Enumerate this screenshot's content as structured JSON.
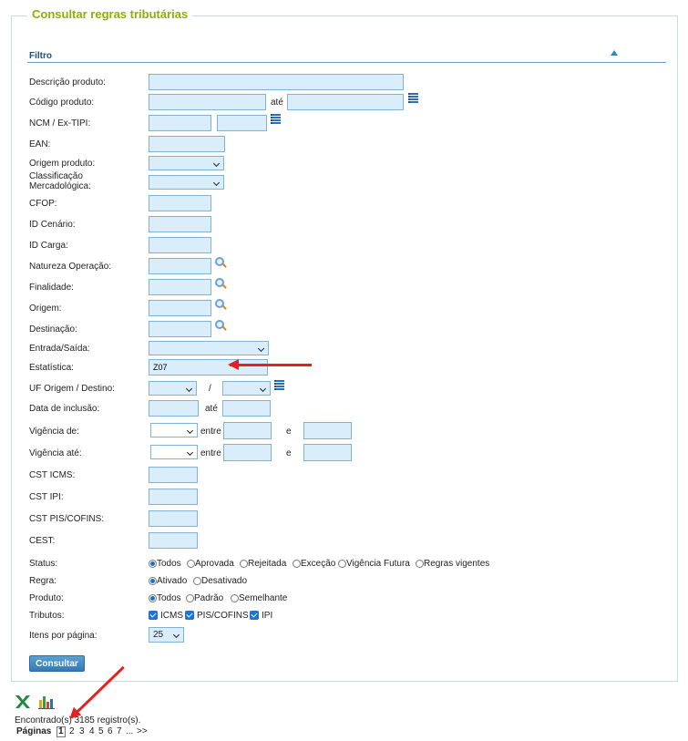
{
  "title": "Consultar regras tributárias",
  "filter": {
    "header": "Filtro"
  },
  "labels": {
    "descricao": "Descrição produto:",
    "codigo": "Código produto:",
    "ncm": "NCM / Ex-TIPI:",
    "ean": "EAN:",
    "origem_produto": "Origem produto:",
    "classificacao_1": "Classificação",
    "classificacao_2": "Mercadológica:",
    "cfop": "CFOP:",
    "id_cenario": "ID Cenário:",
    "id_carga": "ID Carga:",
    "natureza": "Natureza Operação:",
    "finalidade": "Finalidade:",
    "origem": "Origem:",
    "destinacao": "Destinação:",
    "entrada_saida": "Entrada/Saída:",
    "estatistica": "Estatística:",
    "uf": "UF Origem / Destino:",
    "data_inclusao": "Data de inclusão:",
    "vigencia_de": "Vigência de:",
    "vigencia_ate": "Vigência até:",
    "cst_icms": "CST ICMS:",
    "cst_ipi": "CST IPI:",
    "cst_pis": "CST PIS/COFINS:",
    "cest": "CEST:",
    "status": "Status:",
    "regra": "Regra:",
    "produto": "Produto:",
    "tributos": "Tributos:",
    "itens": "Itens por página:"
  },
  "words": {
    "ate": "até",
    "slash": "/",
    "entre": "entre",
    "e": "e"
  },
  "values": {
    "estatistica": "Z07",
    "itens_por_pagina": "25"
  },
  "status_options": [
    "Todos",
    "Aprovada",
    "Rejeitada",
    "Exceção",
    "Vigência Futura",
    "Regras vigentes"
  ],
  "regra_options": [
    "Ativado",
    "Desativado"
  ],
  "produto_options": [
    "Todos",
    "Padrão",
    "Semelhante"
  ],
  "tributos_options": [
    "ICMS",
    "PIS/COFINS",
    "IPI"
  ],
  "button": {
    "consultar": "Consultar"
  },
  "results": {
    "found": "Encontrado(s) 3185 registro(s).",
    "pages_label": "Páginas",
    "pages": [
      "1",
      "2",
      "3",
      "4",
      "5",
      "6",
      "7",
      "...",
      ">>"
    ]
  },
  "icons": [
    "list-icon",
    "search-icon",
    "excel-icon",
    "chart-icon",
    "arrow-annotation"
  ],
  "colors": {
    "title": "#8bb000",
    "input_bg": "#d9eefa",
    "input_border": "#7fb2d6",
    "accent": "#1a6fd0",
    "annotation": "#e32121"
  }
}
